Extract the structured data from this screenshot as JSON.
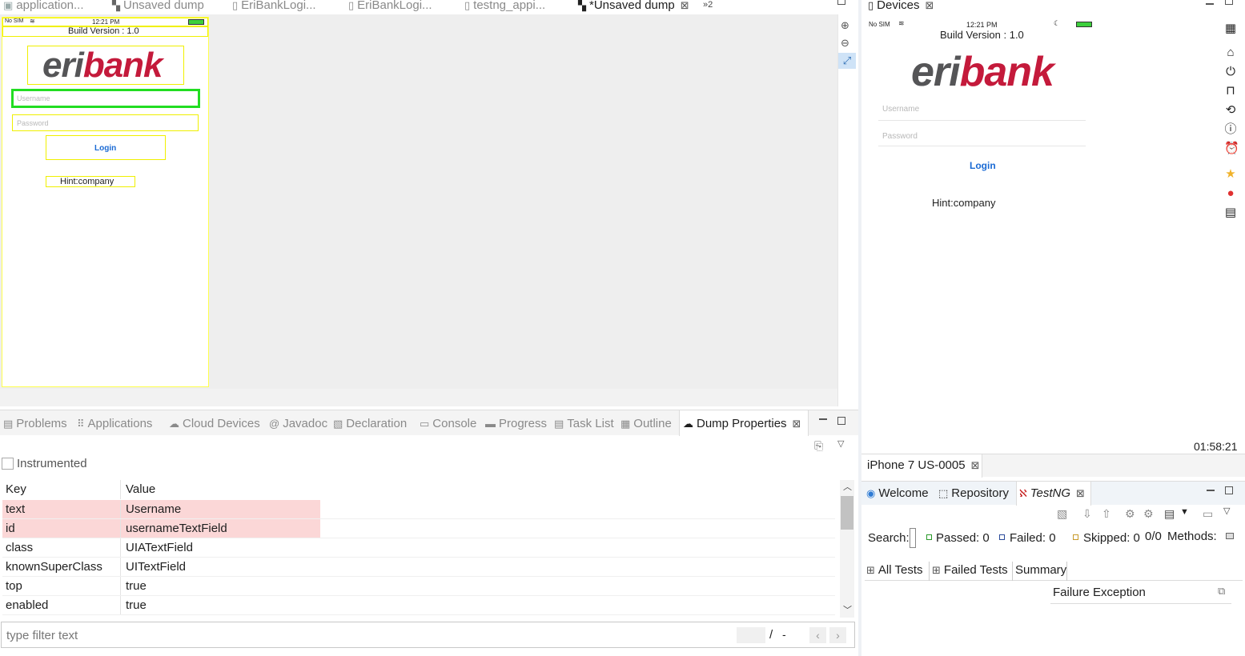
{
  "editor_tabs": [
    {
      "label": "application...",
      "icon": "app-icon"
    },
    {
      "label": "Unsaved dump",
      "icon": "dump-icon"
    },
    {
      "label": "EriBankLogi...",
      "icon": "java-file-icon"
    },
    {
      "label": "EriBankLogi...",
      "icon": "java-file-icon"
    },
    {
      "label": "testng_appi...",
      "icon": "xml-file-icon"
    },
    {
      "label": "*Unsaved dump",
      "icon": "dump-icon",
      "active": true
    }
  ],
  "editor_overflow": "»2",
  "dump_phone": {
    "carrier": "No SIM",
    "time": "12:21 PM",
    "build_version": "Build Version : 1.0",
    "logo_part1": "eri",
    "logo_part2": "bank",
    "username_placeholder": "Username",
    "password_placeholder": "Password",
    "login_label": "Login",
    "hint": "Hint:company"
  },
  "bottom_tabs": [
    {
      "label": "Problems"
    },
    {
      "label": "Applications"
    },
    {
      "label": "Cloud Devices"
    },
    {
      "label": "Javadoc"
    },
    {
      "label": "Declaration"
    },
    {
      "label": "Console"
    },
    {
      "label": "Progress"
    },
    {
      "label": "Task List"
    },
    {
      "label": "Outline"
    },
    {
      "label": "Dump Properties",
      "active": true
    }
  ],
  "dump_properties": {
    "instrumented_label": "Instrumented",
    "instrumented_checked": false,
    "columns": [
      "Key",
      "Value"
    ],
    "rows": [
      {
        "key": "text",
        "value": "Username",
        "highlight": true
      },
      {
        "key": "id",
        "value": "usernameTextField",
        "highlight": true
      },
      {
        "key": "class",
        "value": "UIATextField"
      },
      {
        "key": "knownSuperClass",
        "value": "UITextField"
      },
      {
        "key": "top",
        "value": "true"
      },
      {
        "key": "enabled",
        "value": "true"
      }
    ],
    "filter_placeholder": "type filter text",
    "page_sep": "/",
    "page_total": "-"
  },
  "devices": {
    "title": "Devices",
    "carrier": "No SIM",
    "time": "12:21 PM",
    "build_version": "Build Version : 1.0",
    "logo_part1": "eri",
    "logo_part2": "bank",
    "username_placeholder": "Username",
    "password_placeholder": "Password",
    "login_label": "Login",
    "hint": "Hint:company",
    "clock": "01:58:21",
    "device_tab": "iPhone 7 US-0005",
    "side_icons": [
      "grid-icon",
      "home-icon",
      "power-icon",
      "lock-icon",
      "rotate-icon",
      "info-icon",
      "alarm-icon",
      "star-icon",
      "record-icon",
      "inspect-icon"
    ]
  },
  "testng": {
    "tabs": [
      {
        "label": "Welcome"
      },
      {
        "label": "Repository"
      },
      {
        "label": "TestNG",
        "active": true
      }
    ],
    "search_label": "Search:",
    "passed": "Passed: 0",
    "failed": "Failed: 0",
    "skipped": "Skipped: 0",
    "runs": "0/0",
    "methods": "Methods:",
    "subtabs": [
      "All Tests",
      "Failed Tests",
      "Summary"
    ],
    "failure_exception": "Failure Exception"
  },
  "colors": {
    "accent_red": "#c41a3b",
    "logo_grey": "#555557",
    "link_blue": "#1a6ad4",
    "highlight_row": "#fbd7d7",
    "green_outline": "#22dd22",
    "yellow_outline": "#f0f000"
  }
}
